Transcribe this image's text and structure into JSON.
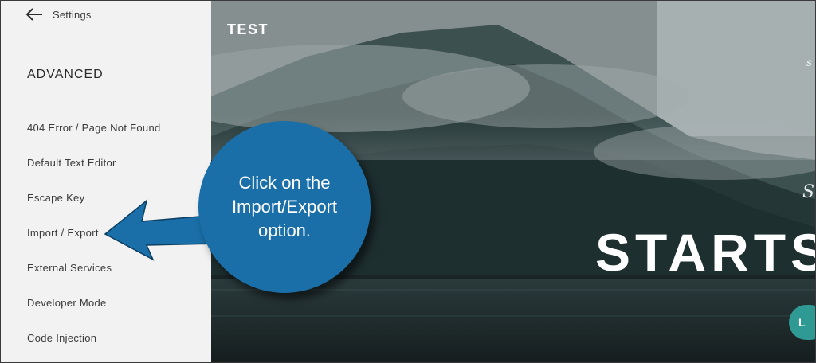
{
  "sidebar": {
    "back_label": "Settings",
    "section_title": "ADVANCED",
    "items": [
      {
        "label": "404 Error / Page Not Found"
      },
      {
        "label": "Default Text Editor"
      },
      {
        "label": "Escape Key"
      },
      {
        "label": "Import / Export"
      },
      {
        "label": "External Services"
      },
      {
        "label": "Developer Mode"
      },
      {
        "label": "Code Injection"
      }
    ]
  },
  "preview": {
    "site_title": "TEST",
    "hero_heading": "STARTS",
    "hero_script": "St",
    "top_script": "s",
    "cta_label": "L"
  },
  "callout": {
    "text": "Click on the Import/Export option.",
    "color": "#1a6fa8"
  },
  "colors": {
    "sidebar_bg": "#f2f2f2",
    "cta": "#2f9a94"
  }
}
